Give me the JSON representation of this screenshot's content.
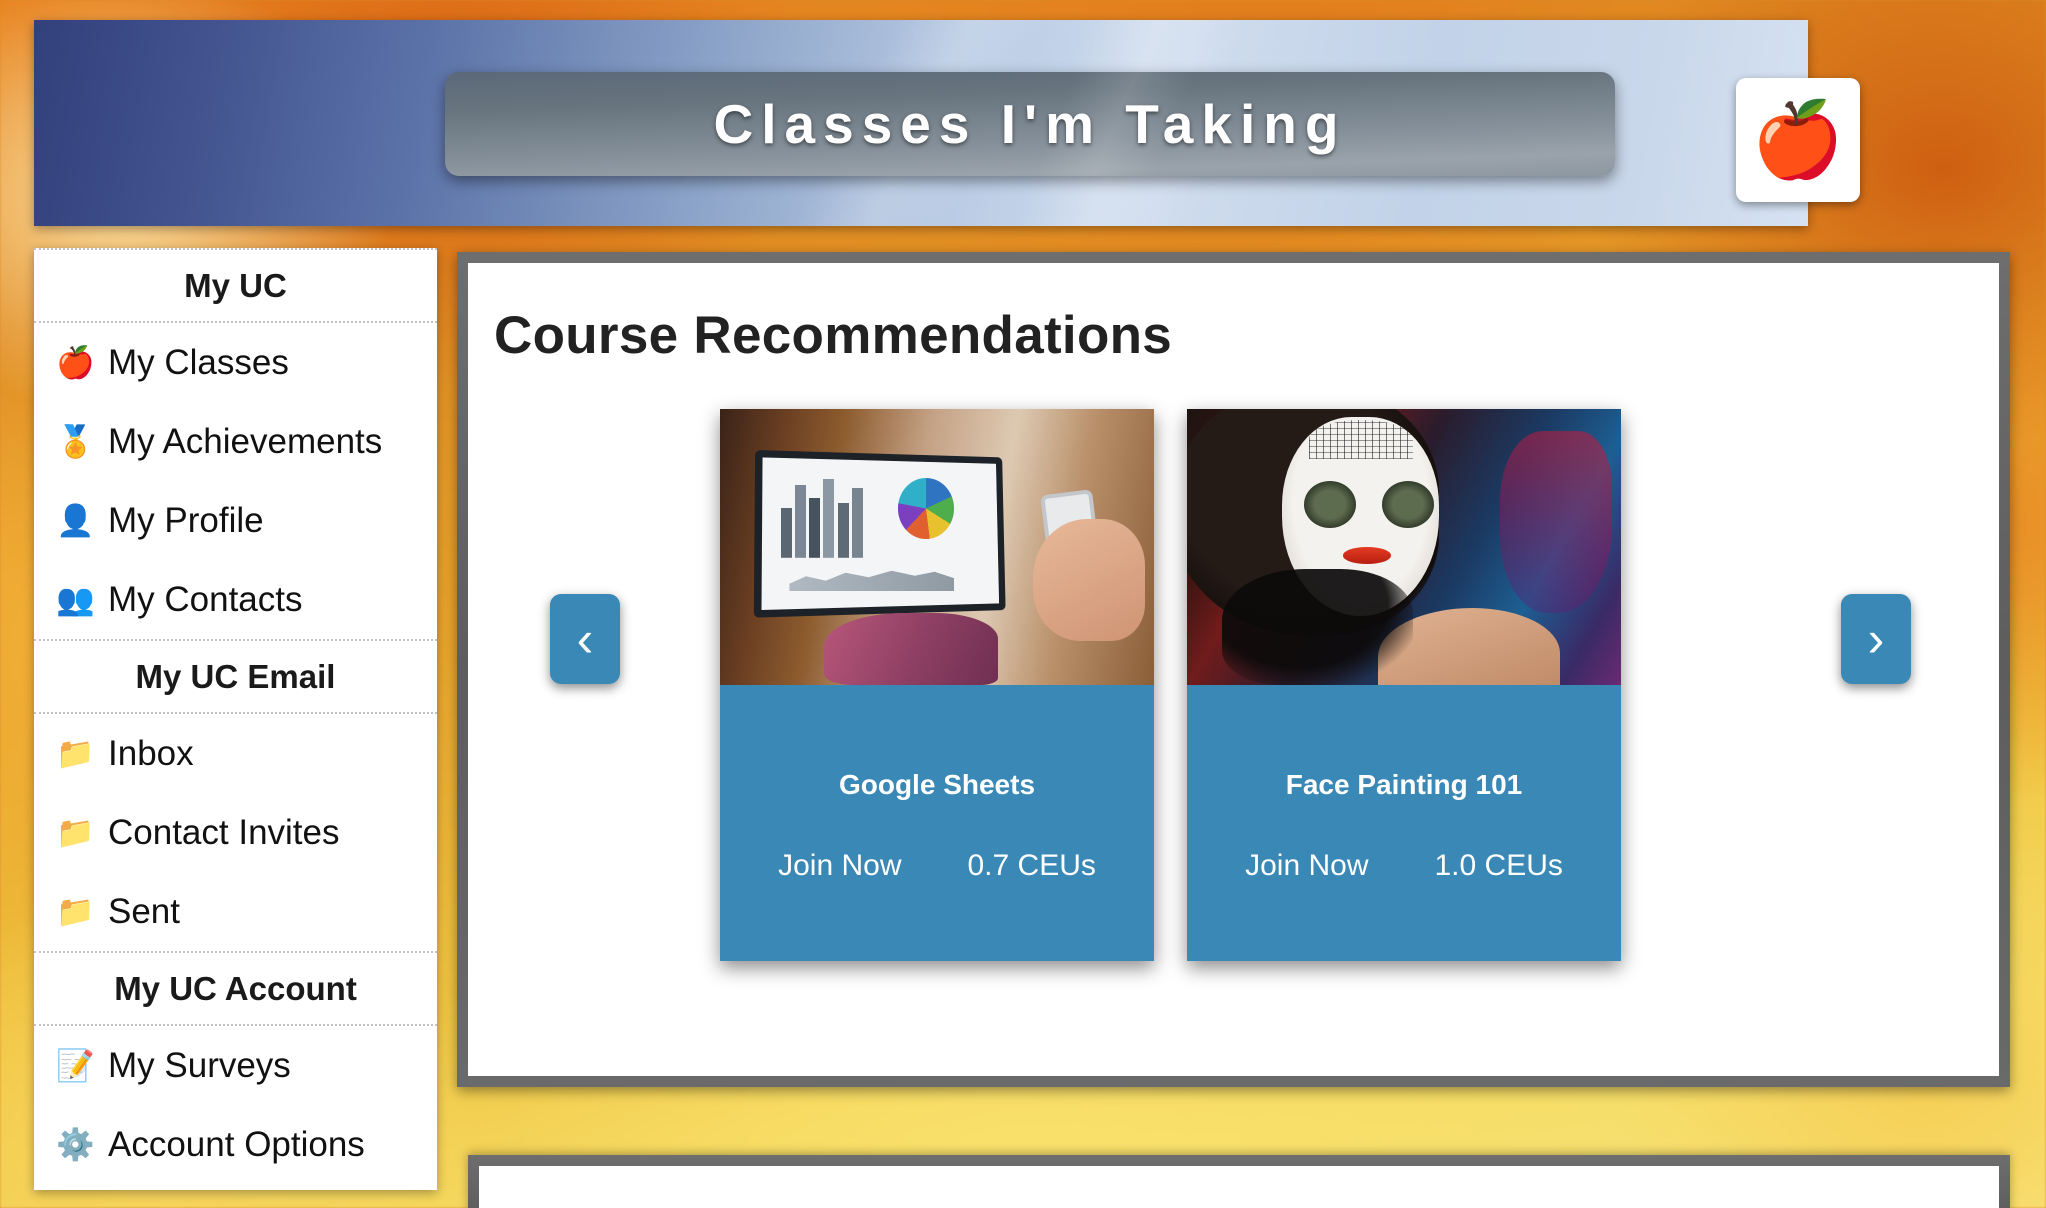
{
  "header": {
    "title": "Classes I'm Taking",
    "logo_icon": "red-apple-logo",
    "logo_glyph": "🍎"
  },
  "sidebar": {
    "sections": [
      {
        "heading": "My UC",
        "items": [
          {
            "label": "My Classes",
            "icon": "apple-icon",
            "glyph": "🍎"
          },
          {
            "label": "My Achievements",
            "icon": "medal-icon",
            "glyph": "🏅"
          },
          {
            "label": "My Profile",
            "icon": "person-icon",
            "glyph": "👤"
          },
          {
            "label": "My Contacts",
            "icon": "contacts-icon",
            "glyph": "👥"
          }
        ]
      },
      {
        "heading": "My UC Email",
        "items": [
          {
            "label": "Inbox",
            "icon": "folder-icon",
            "glyph": "📁"
          },
          {
            "label": "Contact Invites",
            "icon": "folder-icon",
            "glyph": "📁"
          },
          {
            "label": "Sent",
            "icon": "folder-icon",
            "glyph": "📁"
          }
        ]
      },
      {
        "heading": "My UC Account",
        "items": [
          {
            "label": "My Surveys",
            "icon": "pencil-icon",
            "glyph": "📝"
          },
          {
            "label": "Account Options",
            "icon": "gear-icon",
            "glyph": "⚙️"
          }
        ]
      }
    ]
  },
  "main": {
    "section_title": "Course Recommendations",
    "carousel": {
      "prev_label": "‹",
      "next_label": "›",
      "prev_icon": "chevron-left-icon",
      "next_icon": "chevron-right-icon",
      "cards": [
        {
          "title": "Google Sheets",
          "join_label": "Join Now",
          "ceus": "0.7 CEUs",
          "image": "laptop-spreadsheet-charts-photo"
        },
        {
          "title": "Face Painting 101",
          "join_label": "Join Now",
          "ceus": "1.0 CEUs",
          "image": "sugar-skull-face-paint-photo"
        }
      ]
    }
  },
  "colors": {
    "card_blue": "#3a88b5",
    "panel_border_gray": "#5d5d5d",
    "header_navy": "#32407c",
    "header_light_blue": "#d6e2f2"
  }
}
